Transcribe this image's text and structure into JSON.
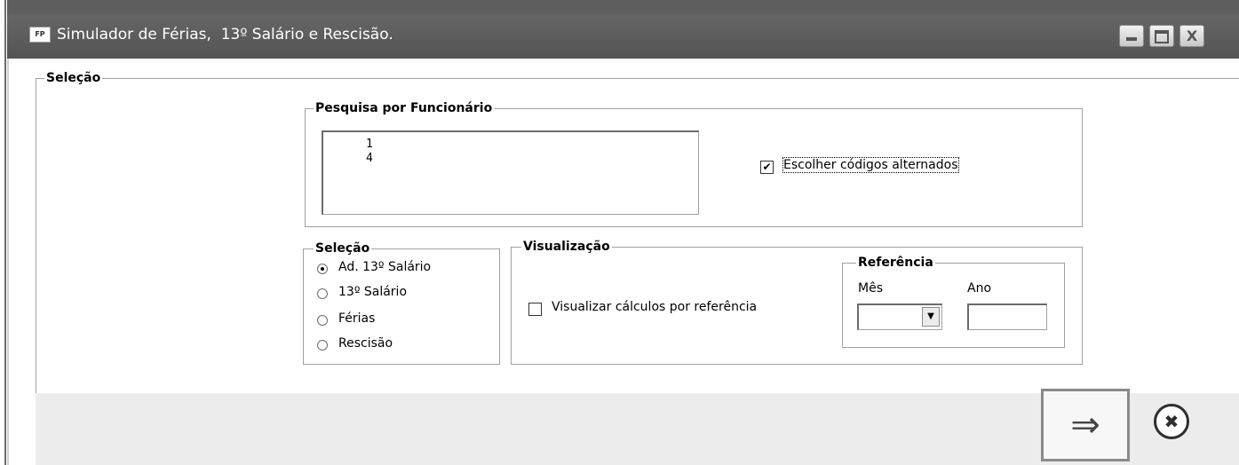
{
  "window": {
    "title": "Simulador de Férias,  13º Salário e Rescisão.",
    "app_icon_text": "FP",
    "minimize_label": "_",
    "maximize_label": "",
    "close_label": "X"
  },
  "selection_group": {
    "legend": "Seleção"
  },
  "employee_search": {
    "legend": "Pesquisa por Funcionário",
    "items": [
      "1",
      "4"
    ],
    "alt_codes_checkbox": {
      "label": "Escolher códigos alternados",
      "checked": true
    }
  },
  "type_group": {
    "legend": "Seleção",
    "options": [
      {
        "label": "Ad. 13º Salário",
        "selected": true
      },
      {
        "label": "13º Salário",
        "selected": false
      },
      {
        "label": "Férias",
        "selected": false
      },
      {
        "label": "Rescisão",
        "selected": false
      }
    ]
  },
  "view_group": {
    "legend": "Visualização",
    "by_reference_checkbox": {
      "label": "Visualizar cálculos por referência",
      "checked": false
    },
    "reference": {
      "legend": "Referência",
      "month_label": "Mês",
      "month_value": "",
      "year_label": "Ano",
      "year_value": ""
    }
  },
  "footer": {
    "next_symbol": "⇒",
    "cancel_symbol": "✖"
  },
  "colors": {
    "titlebar": "#5e5e5e",
    "footer": "#ececec",
    "border": "#a0a0a0"
  }
}
